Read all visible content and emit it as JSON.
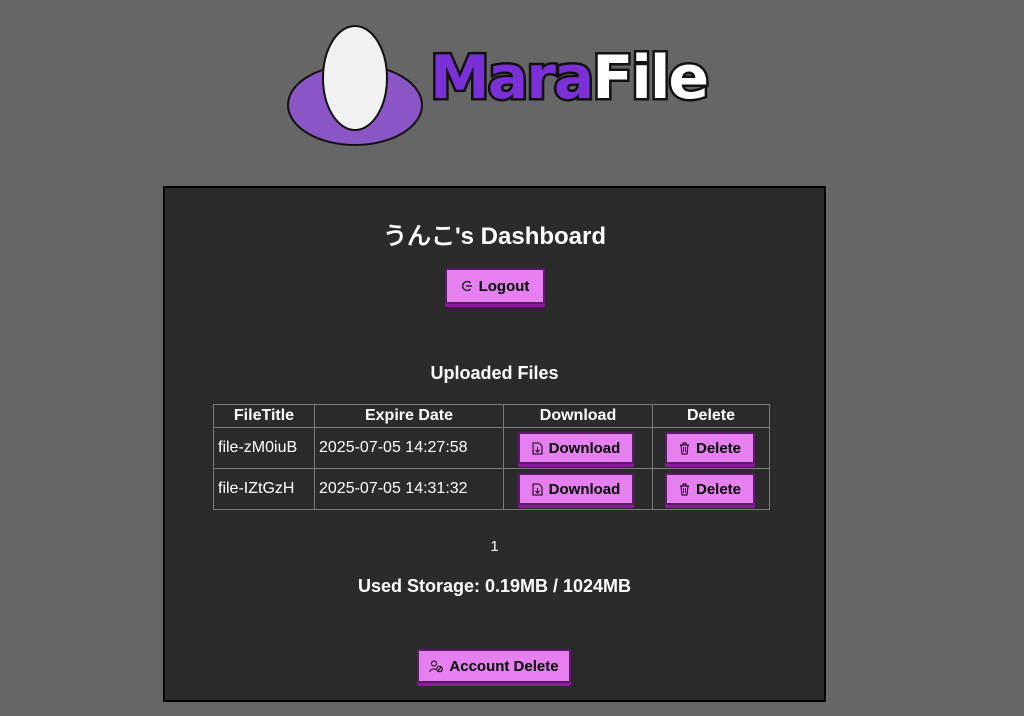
{
  "logo": {
    "part1": "Mara",
    "part2": "File"
  },
  "dashboard": {
    "title": "うんこ's Dashboard"
  },
  "logout_label": "Logout",
  "files": {
    "heading": "Uploaded Files",
    "columns": [
      "FileTitle",
      "Expire Date",
      "Download",
      "Delete"
    ],
    "rows": [
      {
        "title": "file-zM0iuB",
        "expire": "2025-07-05 14:27:58",
        "download_label": "Download",
        "delete_label": "Delete"
      },
      {
        "title": "file-IZtGzH",
        "expire": "2025-07-05 14:31:32",
        "download_label": "Download",
        "delete_label": "Delete"
      }
    ]
  },
  "pagination": {
    "current": "1"
  },
  "storage": {
    "text": "Used Storage: 0.19MB / 1024MB"
  },
  "account_delete_label": "Account Delete",
  "colors": {
    "background": "#666666",
    "panel": "#2b2b2b",
    "button": "#e67ff0",
    "brand_purple": "#7b2fd6"
  }
}
